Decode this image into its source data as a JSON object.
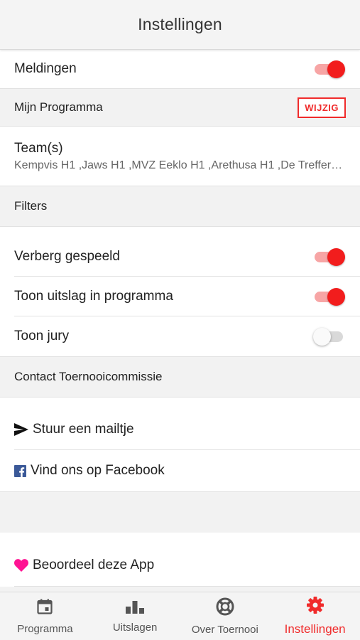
{
  "header": {
    "title": "Instellingen"
  },
  "notifications": {
    "label": "Meldingen",
    "enabled": true
  },
  "my_program": {
    "section_title": "Mijn Programma",
    "edit_label": "WIJZIG",
    "teams_label": "Team(s)",
    "teams_value": "Kempvis H1 ,Jaws H1 ,MVZ Eeklo H1 ,Arethusa H1 ,De Treffers H1"
  },
  "filters": {
    "section_title": "Filters",
    "items": [
      {
        "label": "Verberg gespeeld",
        "enabled": true
      },
      {
        "label": "Toon uitslag in programma",
        "enabled": true
      },
      {
        "label": "Toon jury",
        "enabled": false
      }
    ]
  },
  "contact": {
    "section_title": "Contact Toernooicommissie",
    "mail_label": "Stuur een mailtje",
    "facebook_label": "Vind ons op Facebook"
  },
  "rate": {
    "label": "Beoordeel deze App"
  },
  "tabs": [
    {
      "label": "Programma",
      "icon": "calendar-icon",
      "active": false
    },
    {
      "label": "Uitslagen",
      "icon": "bar-chart-icon",
      "active": false
    },
    {
      "label": "Over Toernooi",
      "icon": "life-ring-icon",
      "active": false
    },
    {
      "label": "Instellingen",
      "icon": "gear-icon",
      "active": true
    }
  ],
  "colors": {
    "accent": "#f02b2b",
    "toggle_on_track": "#f7a5a5",
    "facebook": "#3b5998",
    "heart": "#ff1493"
  }
}
